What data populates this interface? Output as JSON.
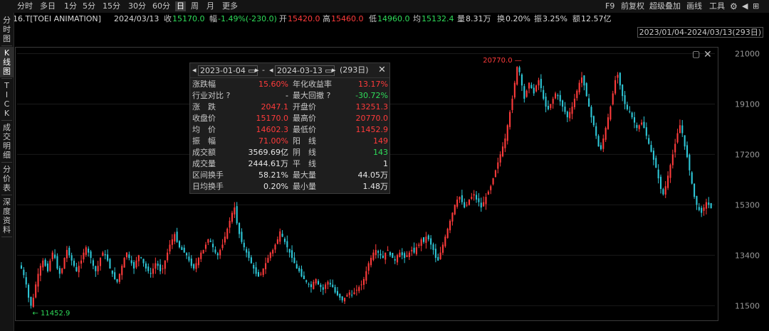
{
  "toolbar": {
    "periods": [
      "分时",
      "多日",
      "1分",
      "5分",
      "15分",
      "30分",
      "60分",
      "日",
      "周",
      "月",
      "更多"
    ],
    "active_period": "日",
    "right_items": [
      "F9",
      "前复权",
      "超级叠加",
      "画线",
      "工具"
    ]
  },
  "info": {
    "code_name": "4816.T[TOEI ANIMATION]",
    "date": "2024/03/13",
    "close_label": "收",
    "close": "15170.0",
    "change_label": "幅",
    "change": "-1.49%(-230.0)",
    "open_label": "开",
    "open": "15420.0",
    "high_label": "高",
    "high": "15460.0",
    "low_label": "低",
    "low": "14960.0",
    "avg_label": "均",
    "avg": "15132.4",
    "volume_label": "量",
    "volume": "8.31万",
    "turnover_label": "换",
    "turnover": "0.20%",
    "amplitude_label": "振",
    "amplitude": "3.25%",
    "amount_label": "额",
    "amount": "12.57亿"
  },
  "leftbar": {
    "items": [
      {
        "label": "分时图",
        "active": false
      },
      {
        "label": "K线图",
        "active": true
      },
      {
        "label": "TICK",
        "active": false
      },
      {
        "label": "成交明细",
        "active": false
      },
      {
        "label": "分价表",
        "active": false
      },
      {
        "label": "深度资料",
        "active": false
      }
    ]
  },
  "range_label": "2023/01/04-2024/03/13(293日)",
  "stats": {
    "start_date": "2023-01-04",
    "end_date": "2024-03-13",
    "sep": "-",
    "days": "(293日)",
    "rows": [
      {
        "l1": "涨跌幅",
        "v1": "15.60%",
        "c1": "red",
        "l2": "年化收益率",
        "v2": "13.17%",
        "c2": "red"
      },
      {
        "l1": "行业对比 ?",
        "v1": "-",
        "c1": "white",
        "l2": "最大回撤 ?",
        "v2": "-30.72%",
        "c2": "green"
      },
      {
        "l1": "涨　跌",
        "v1": "2047.1",
        "c1": "red",
        "l2": "开盘价",
        "v2": "13251.3",
        "c2": "red"
      },
      {
        "l1": "收盘价",
        "v1": "15170.0",
        "c1": "red",
        "l2": "最高价",
        "v2": "20770.0",
        "c2": "red"
      },
      {
        "l1": "均　价",
        "v1": "14602.3",
        "c1": "red",
        "l2": "最低价",
        "v2": "11452.9",
        "c2": "red"
      },
      {
        "l1": "振　幅",
        "v1": "71.00%",
        "c1": "red",
        "l2": "阳　线",
        "v2": "149",
        "c2": "red"
      },
      {
        "l1": "成交额",
        "v1": "3569.69亿",
        "c1": "white",
        "l2": "阴　线",
        "v2": "143",
        "c2": "green"
      },
      {
        "l1": "成交量",
        "v1": "2444.61万",
        "c1": "white",
        "l2": "平　线",
        "v2": "1",
        "c2": "white"
      },
      {
        "l1": "区间换手",
        "v1": "58.21%",
        "c1": "white",
        "l2": "最大量",
        "v2": "44.05万",
        "c2": "white"
      },
      {
        "l1": "日均换手",
        "v1": "0.20%",
        "c1": "white",
        "l2": "最小量",
        "v2": "1.48万",
        "c2": "white"
      }
    ]
  },
  "colors": {
    "up": "#ff3b3b",
    "down": "#2ec8d8",
    "grid": "#1a1a1a"
  },
  "chart_data": {
    "type": "candlestick",
    "ylim": [
      11000,
      21200
    ],
    "y_ticks": [
      21000,
      19100,
      17200,
      15300,
      13400,
      11500
    ],
    "high_label": "20770.0",
    "low_label": "11452.9",
    "closes": [
      12900,
      12650,
      12300,
      11800,
      11500,
      11800,
      12300,
      12700,
      13000,
      13200,
      13000,
      12800,
      13200,
      13500,
      13300,
      12900,
      12700,
      12900,
      13300,
      13600,
      13400,
      13200,
      13000,
      12800,
      13000,
      13200,
      13500,
      13700,
      13500,
      13300,
      13000,
      12800,
      13000,
      13300,
      13500,
      13400,
      13200,
      12900,
      12700,
      12500,
      12400,
      12700,
      13000,
      13300,
      13500,
      13300,
      13100,
      12900,
      13200,
      13400,
      13300,
      13100,
      12900,
      12800,
      12700,
      12900,
      13100,
      13000,
      12800,
      12900,
      13200,
      13500,
      13800,
      14000,
      14200,
      13900,
      13700,
      13600,
      13500,
      13400,
      13200,
      13000,
      12900,
      13100,
      13300,
      13500,
      13600,
      13800,
      14000,
      13900,
      13700,
      13500,
      13400,
      13600,
      13800,
      14100,
      14400,
      14700,
      15000,
      15200,
      14600,
      14200,
      13900,
      13700,
      13500,
      13300,
      13100,
      12900,
      12700,
      12600,
      12700,
      12900,
      13100,
      13300,
      13500,
      13600,
      13800,
      14000,
      14300,
      14100,
      13900,
      13700,
      13500,
      13300,
      13100,
      12900,
      12800,
      12600,
      12500,
      12400,
      12300,
      12200,
      12400,
      12500,
      12300,
      12200,
      12100,
      12300,
      12400,
      12300,
      12200,
      12000,
      11900,
      11800,
      11700,
      11800,
      11900,
      12000,
      11900,
      12000,
      12100,
      12200,
      12300,
      12500,
      12800,
      13100,
      13300,
      13500,
      13600,
      13500,
      13400,
      13300,
      13500,
      13600,
      13400,
      13300,
      13200,
      13400,
      13500,
      13400,
      13300,
      13400,
      13500,
      13600,
      13500,
      13700,
      13800,
      14000,
      13900,
      14100,
      14000,
      13800,
      13600,
      13300,
      13200,
      13500,
      13800,
      14100,
      14400,
      14700,
      15000,
      15300,
      15500,
      15600,
      15400,
      15200,
      15300,
      15500,
      15600,
      15700,
      15500,
      15400,
      15200,
      15400,
      15600,
      15800,
      16000,
      16300,
      16600,
      16900,
      17200,
      17500,
      17800,
      18300,
      18800,
      19300,
      19900,
      20500,
      20300,
      19800,
      19300,
      19600,
      19900,
      19700,
      19500,
      19800,
      20000,
      19700,
      19300,
      19000,
      18900,
      19100,
      19300,
      19500,
      19400,
      19200,
      19000,
      18800,
      18600,
      18800,
      19000,
      19300,
      19600,
      19900,
      20100,
      19800,
      19400,
      19000,
      18600,
      18300,
      17900,
      17500,
      17400,
      17800,
      18200,
      18600,
      19000,
      19500,
      20000,
      20200,
      19800,
      19400,
      19100,
      18900,
      18800,
      18600,
      18400,
      18200,
      18300,
      18400,
      18200,
      17900,
      17600,
      17300,
      17000,
      16700,
      16300,
      15900,
      15700,
      16000,
      16400,
      16800,
      17200,
      17600,
      18000,
      18300,
      18000,
      17500,
      17100,
      16600,
      16100,
      15600,
      15300,
      15100,
      15000,
      15200,
      15400,
      15300,
      15170
    ]
  }
}
